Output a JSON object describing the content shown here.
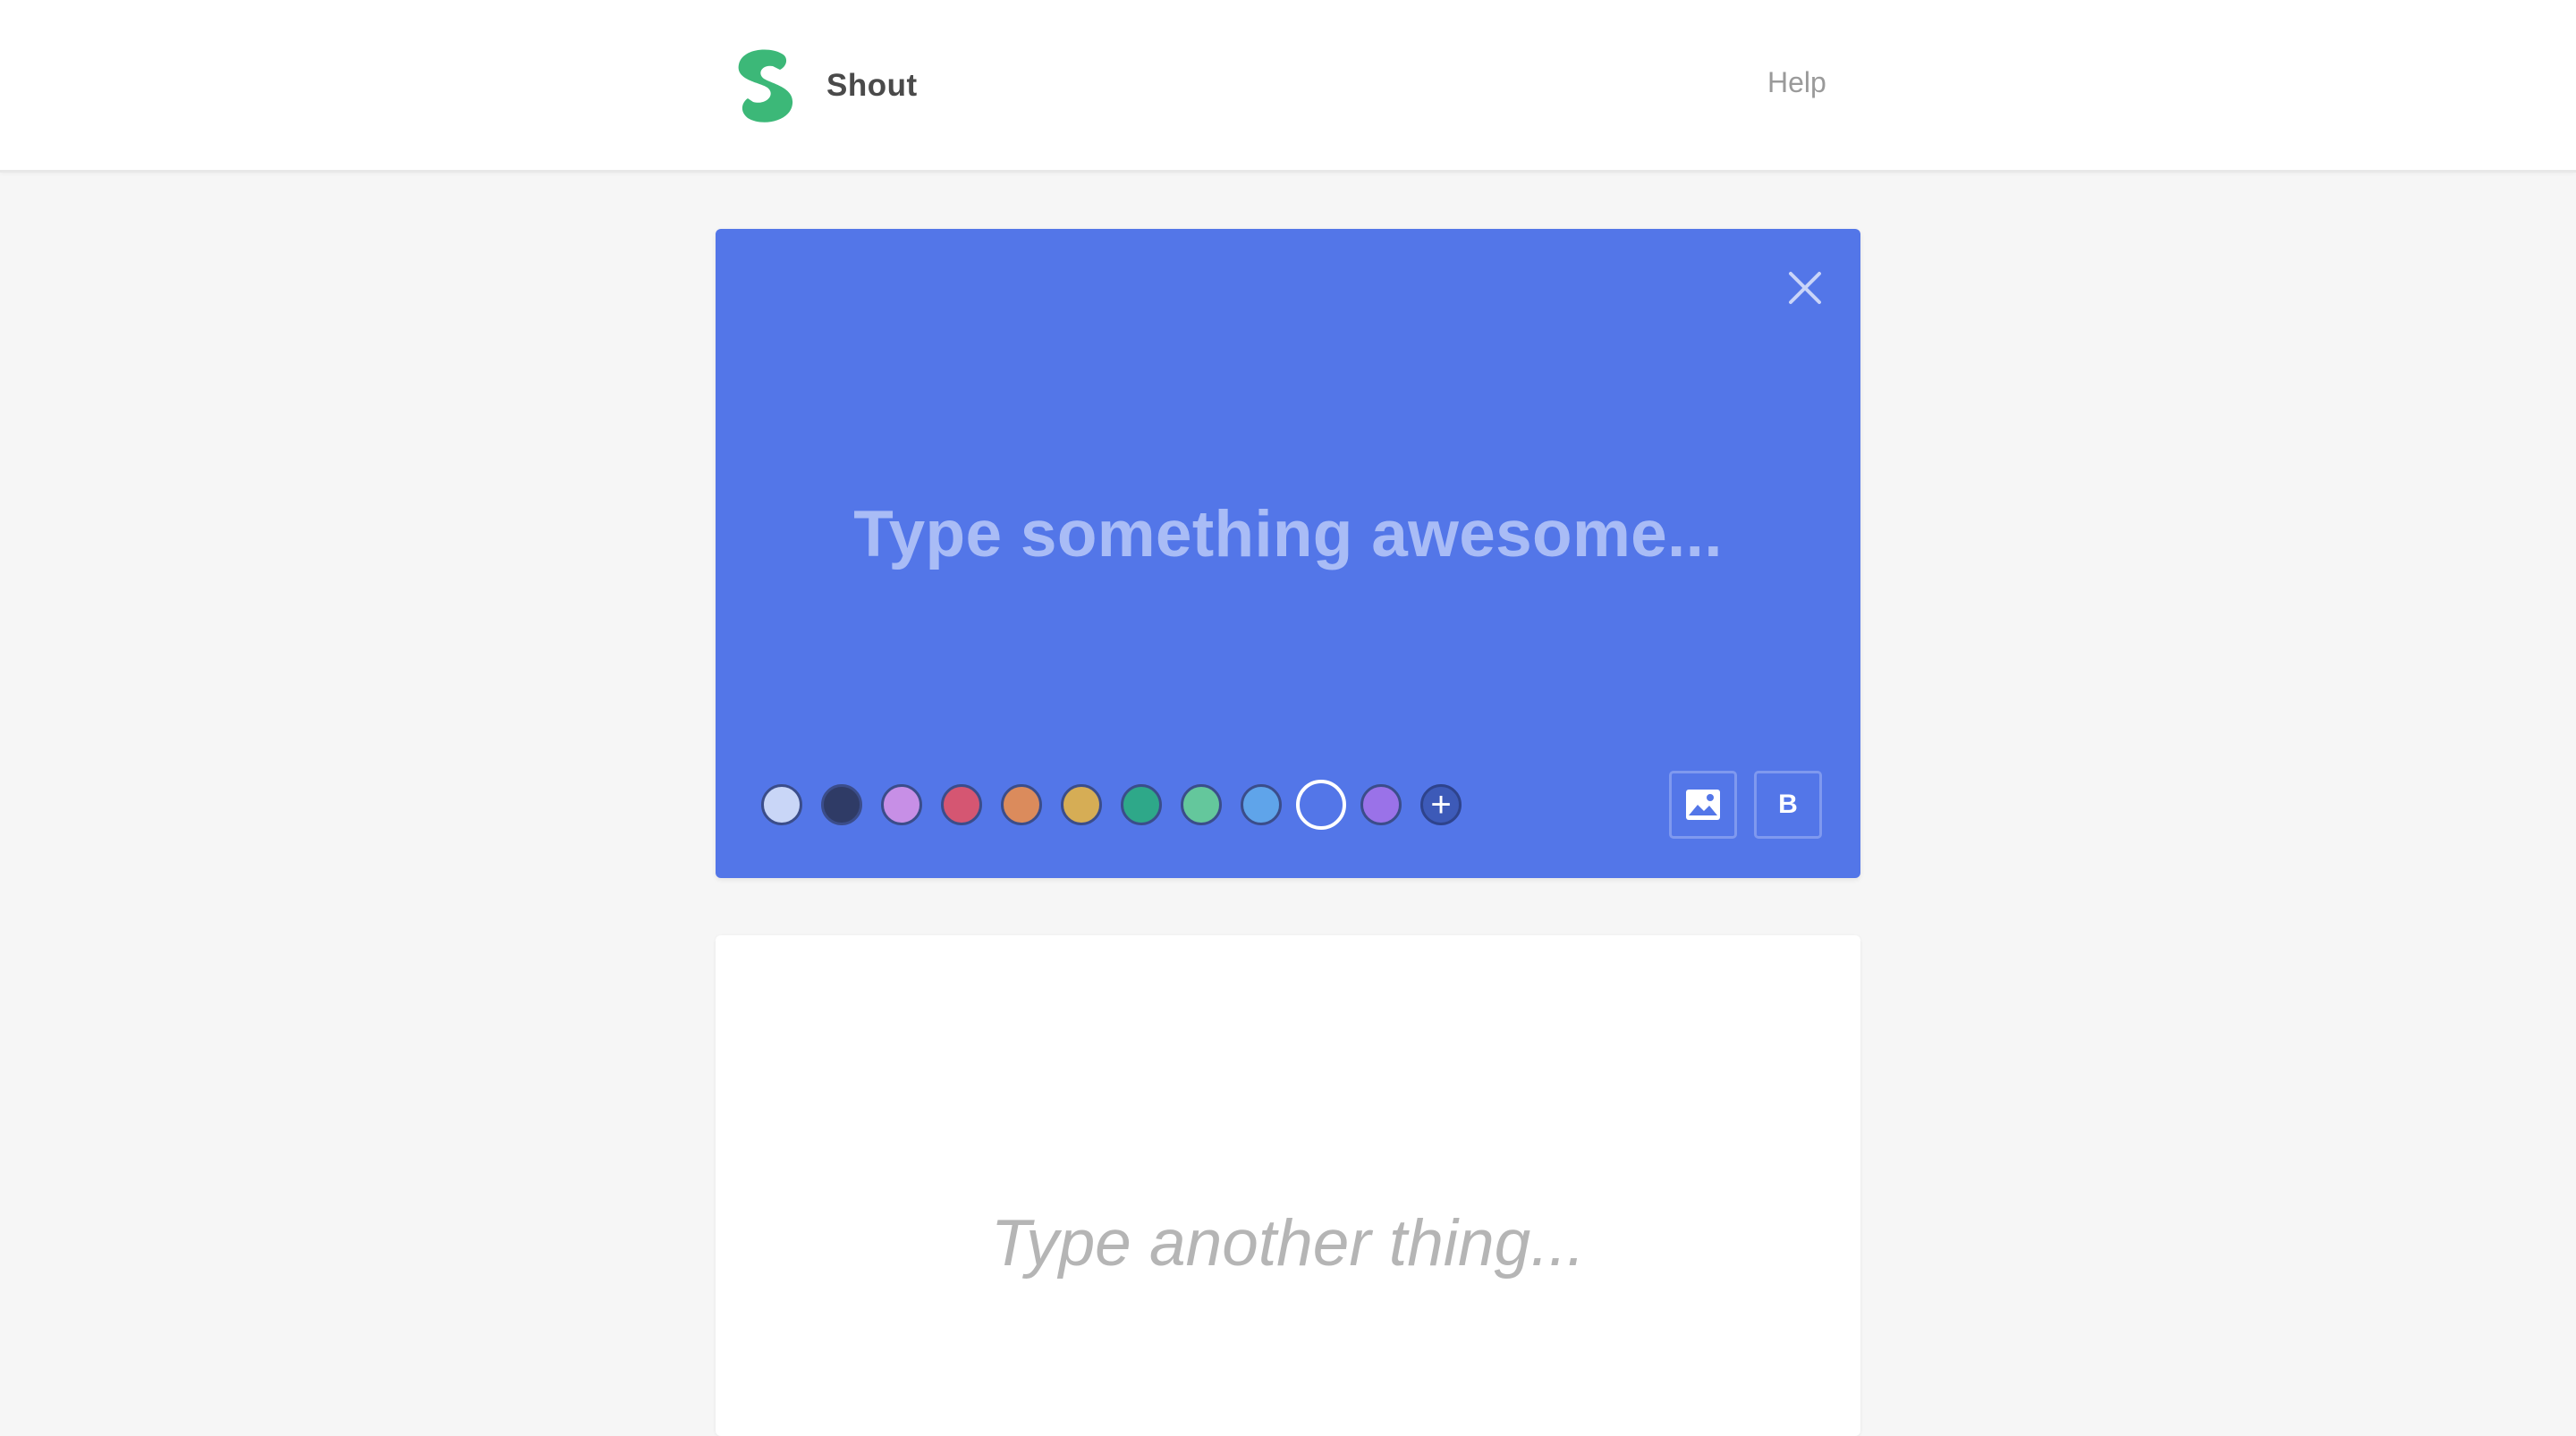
{
  "header": {
    "brand_name": "Shout",
    "help_label": "Help",
    "logo_color": "#3cb878"
  },
  "editor_card": {
    "background_color": "#5376e8",
    "placeholder_text": "Type something awesome...",
    "close_icon": "close-icon",
    "palette": [
      {
        "name": "light-lavender",
        "color": "#c9d6f7"
      },
      {
        "name": "navy",
        "color": "#2f3b66"
      },
      {
        "name": "lilac",
        "color": "#c78fe6"
      },
      {
        "name": "red",
        "color": "#d55672"
      },
      {
        "name": "orange",
        "color": "#db8b5c"
      },
      {
        "name": "yellow",
        "color": "#d6ad55"
      },
      {
        "name": "teal",
        "color": "#2ea889"
      },
      {
        "name": "mint",
        "color": "#64c79c"
      },
      {
        "name": "sky-blue",
        "color": "#5fa4ea"
      },
      {
        "name": "blue-selected",
        "color": "#5376e8",
        "selected": true
      },
      {
        "name": "purple",
        "color": "#9a72e8"
      }
    ],
    "add_color_label": "+",
    "image_button_icon": "image-icon",
    "bold_button_label": "B"
  },
  "second_card": {
    "placeholder_text": "Type another thing..."
  }
}
